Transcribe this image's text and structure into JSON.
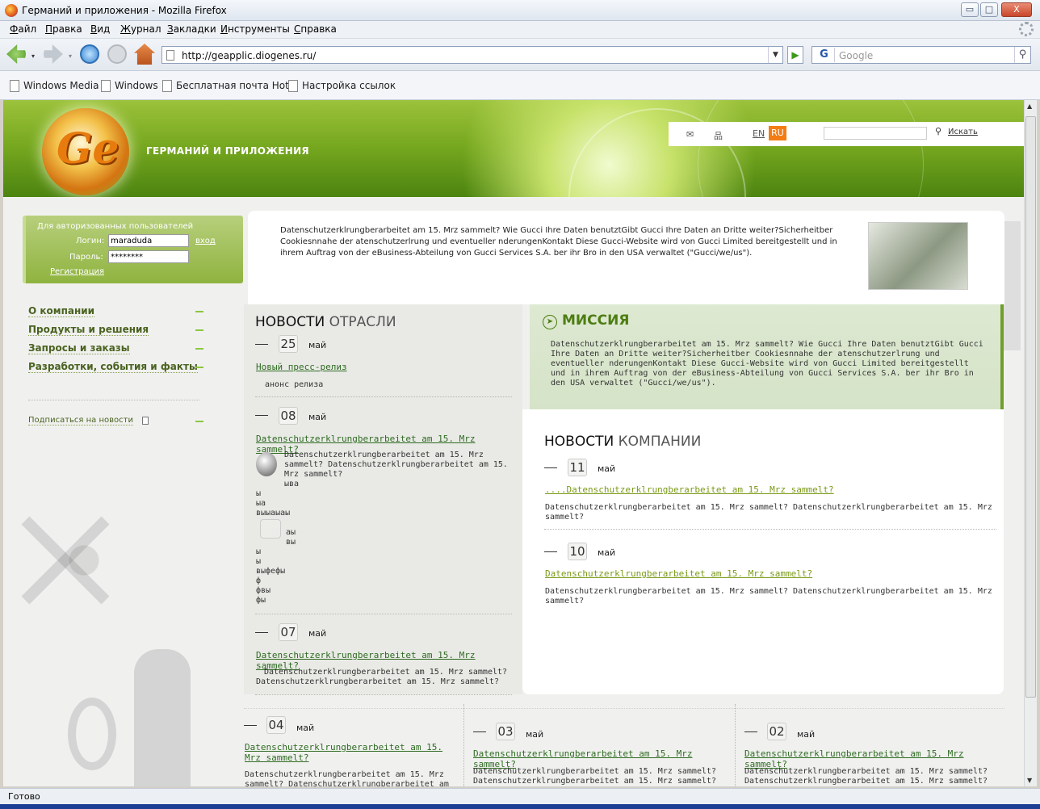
{
  "window": {
    "title": "Германий и приложения - Mozilla Firefox",
    "min": "▭",
    "max": "□",
    "close": "X"
  },
  "menu": [
    "Файл",
    "Правка",
    "Вид",
    "Журнал",
    "Закладки",
    "Инструменты",
    "Справка"
  ],
  "navigation": {
    "url": "http://geapplic.diogenes.ru/",
    "search_placeholder": "Google",
    "search_engine": "G"
  },
  "bookmarks": [
    "Windows Media",
    "Windows",
    "Бесплатная почта Hot...",
    "Настройка ссылок"
  ],
  "status": "Готово",
  "site": {
    "logo_text": "Ge",
    "name": "ГЕРМАНИЙ И ПРИЛОЖЕНИЯ",
    "lang_en": "EN",
    "lang_ru": "RU",
    "search_label": "Искать",
    "mail_icon": "✉",
    "sitemap_icon": "品",
    "search_icon": "⚲"
  },
  "login": {
    "title": "Для авторизованных пользователей",
    "login_label": "Логин:",
    "login_value": "maraduda",
    "enter_link": "вход",
    "password_label": "Пароль:",
    "password_value": "********",
    "register_link": "Регистрация"
  },
  "nav": [
    "О компании",
    "Продукты и решения",
    "Запросы и заказы",
    "Разработки, события и факты"
  ],
  "subscribe": "Подписаться на новости",
  "intro_text": "Datenschutzerklrungberarbeitet am 15. Mrz sammelt? Wie Gucci Ihre Daten benutztGibt Gucci Ihre Daten an Dritte weiter?Sicherheitber Cookiesnnahe der atenschutzerlrung und eventueller nderungenKontakt Diese Gucci-Website wird von Gucci Limited bereitgestellt und in ihrem Auftrag von der eBusiness-Abteilung von Gucci Services S.A. ber ihr Bro in den USA verwaltet (\"Gucci/we/us\").",
  "industry": {
    "title_a": "НОВОСТИ",
    "title_b": "ОТРАСЛИ",
    "items": [
      {
        "day": "25",
        "month": "май",
        "link": "Новый пресс-релиз",
        "text": "анонс релиза"
      },
      {
        "day": "08",
        "month": "май",
        "link": "Datenschutzerklrungberarbeitet am 15. Mrz sammelt?",
        "text": "Datenschutzerklrungberarbeitet am 15. Mrz sammelt? Datenschutzerklrungberarbeitet am 15. Mrz sammelt?",
        "text2": "ыва",
        "extra_a": [
          "ы",
          "ыа",
          "выыаыаы"
        ],
        "extra_b": [
          "аы",
          "вы"
        ],
        "extra_c": [
          "ы",
          "ы",
          "выфефы",
          "ф",
          "фвы",
          "фы"
        ]
      },
      {
        "day": "07",
        "month": "май",
        "link": "Datenschutzerklrungberarbeitet am 15. Mrz sammelt?",
        "text": "Datenschutzerklrungberarbeitet am 15. Mrz sammelt? Datenschutzerklrungberarbeitet am 15. Mrz sammelt?"
      }
    ]
  },
  "mission": {
    "title": "МИССИЯ",
    "text": "Datenschutzerklrungberarbeitet am 15. Mrz sammelt? Wie Gucci Ihre Daten benutztGibt Gucci Ihre Daten an Dritte weiter?Sicherheitber Cookiesnnahe der atenschutzerlrung und eventueller nderungenKontakt Diese Gucci-Website wird von Gucci Limited bereitgestellt und in ihrem Auftrag von der eBusiness-Abteilung von Gucci Services S.A. ber ihr Bro in den USA verwaltet (\"Gucci/we/us\")."
  },
  "company": {
    "title_a": "НОВОСТИ",
    "title_b": "КОМПАНИИ",
    "items": [
      {
        "day": "11",
        "month": "май",
        "link": "....Datenschutzerklrungberarbeitet am 15. Mrz sammelt?",
        "text": "Datenschutzerklrungberarbeitet am 15. Mrz sammelt? Datenschutzerklrungberarbeitet am 15. Mrz sammelt?"
      },
      {
        "day": "10",
        "month": "май",
        "link": "Datenschutzerklrungberarbeitet am 15. Mrz sammelt?",
        "text": "Datenschutzerklrungberarbeitet am 15. Mrz sammelt? Datenschutzerklrungberarbeitet am 15. Mrz sammelt?"
      }
    ]
  },
  "bottom": [
    {
      "day": "04",
      "month": "май",
      "link": "Datenschutzerklrungberarbeitet am 15. Mrz sammelt?",
      "text": "Datenschutzerklrungberarbeitet am 15. Mrz sammelt? Datenschutzerklrungberarbeitet am"
    },
    {
      "day": "03",
      "month": "май",
      "link": "Datenschutzerklrungberarbeitet am 15. Mrz sammelt?",
      "text": "Datenschutzerklrungberarbeitet am 15. Mrz sammelt? Datenschutzerklrungberarbeitet am 15. Mrz sammelt?"
    },
    {
      "day": "02",
      "month": "май",
      "link": "Datenschutzerklrungberarbeitet am 15. Mrz sammelt?",
      "text": "Datenschutzerklrungberarbeitet am 15. Mrz sammelt? Datenschutzerklrungberarbeitet am 15. Mrz sammelt?"
    }
  ]
}
